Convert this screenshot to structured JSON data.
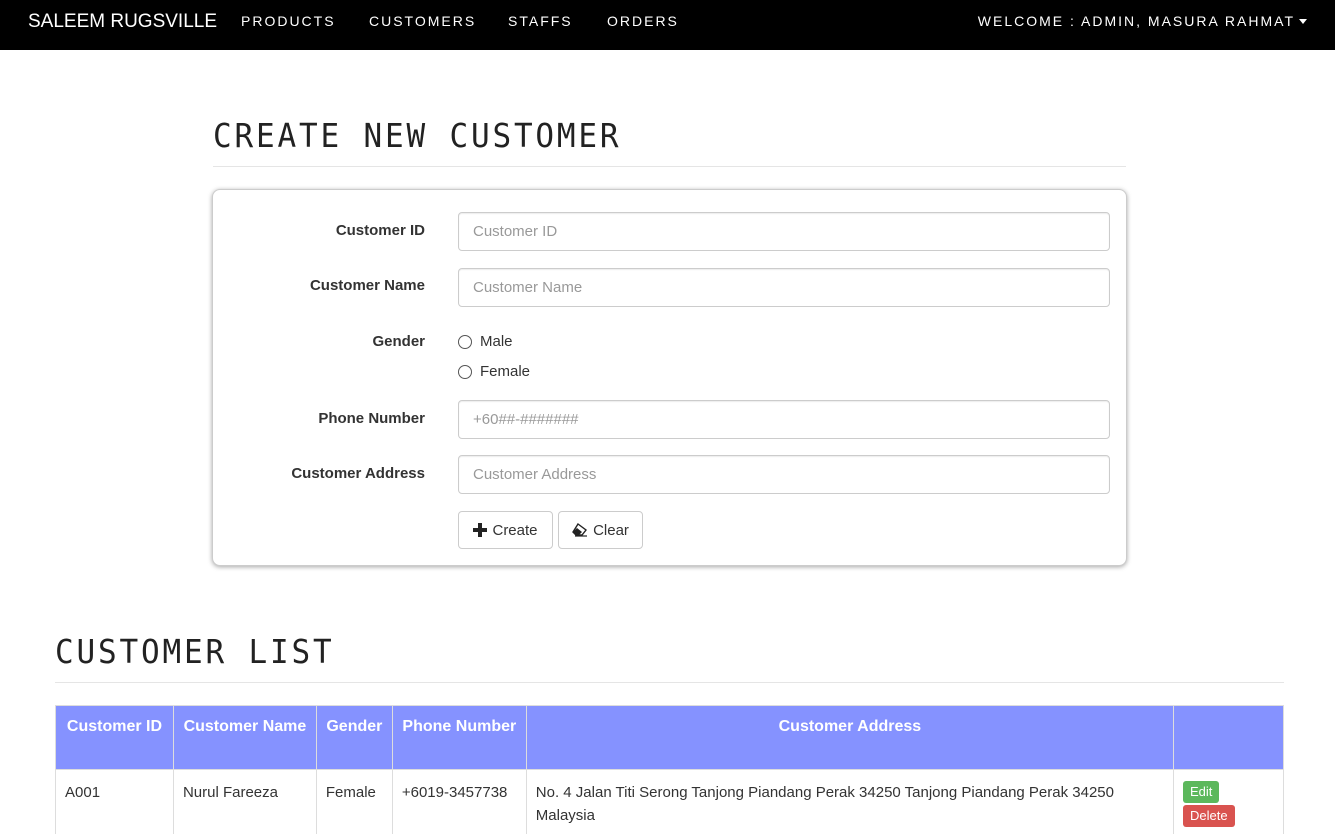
{
  "navbar": {
    "brand": "SALEEM RUGSVILLE",
    "links": [
      "PRODUCTS",
      "CUSTOMERS",
      "STAFFS",
      "ORDERS"
    ],
    "welcome": "WELCOME : ADMIN, MASURA RAHMAT"
  },
  "create": {
    "title": "CREATE NEW CUSTOMER",
    "fields": {
      "id": {
        "label": "Customer ID",
        "placeholder": "Customer ID",
        "value": ""
      },
      "name": {
        "label": "Customer Name",
        "placeholder": "Customer Name",
        "value": ""
      },
      "gender": {
        "label": "Gender",
        "options": [
          "Male",
          "Female"
        ]
      },
      "phone": {
        "label": "Phone Number",
        "placeholder": "+60##-#######",
        "value": ""
      },
      "address": {
        "label": "Customer Address",
        "placeholder": "Customer Address",
        "value": ""
      }
    },
    "buttons": {
      "create": "Create",
      "clear": "Clear"
    }
  },
  "list": {
    "title": "CUSTOMER LIST",
    "columns": [
      "Customer ID",
      "Customer Name",
      "Gender",
      "Phone Number",
      "Customer Address",
      ""
    ],
    "rows": [
      {
        "id": "A001",
        "name": "Nurul Fareeza",
        "gender": "Female",
        "phone": "+6019-3457738",
        "address": "No. 4 Jalan Titi Serong Tanjong Piandang Perak 34250 Tanjong Piandang Perak 34250 Malaysia",
        "edit": "Edit",
        "delete": "Delete"
      }
    ]
  },
  "colors": {
    "navbar_bg": "#000000",
    "table_header_bg": "#8592ff",
    "edit_button": "#5cb85c",
    "delete_button": "#d9534f"
  }
}
